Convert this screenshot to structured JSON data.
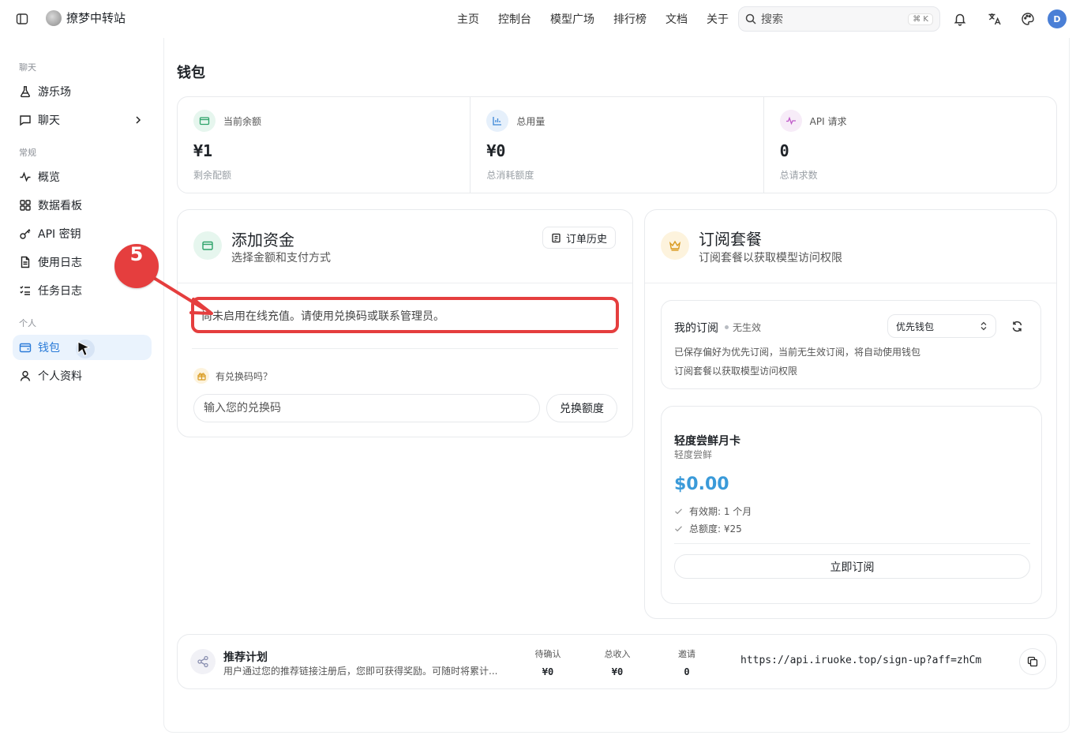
{
  "header": {
    "brand": "撩梦中转站",
    "nav": [
      "主页",
      "控制台",
      "模型广场",
      "排行榜",
      "文档",
      "关于"
    ],
    "search_placeholder": "搜索",
    "search_shortcut": "⌘ K",
    "avatar_initial": "D"
  },
  "sidebar": {
    "sections": {
      "chat": "聊天",
      "general": "常规",
      "personal": "个人"
    },
    "items": {
      "playground": "游乐场",
      "chat": "聊天",
      "overview": "概览",
      "dashboard": "数据看板",
      "api_keys": "API 密钥",
      "usage_logs": "使用日志",
      "task_logs": "任务日志",
      "wallet": "钱包",
      "profile": "个人资料"
    }
  },
  "page": {
    "title": "钱包"
  },
  "stats": [
    {
      "label": "当前余额",
      "value": "¥1",
      "sub": "剩余配额"
    },
    {
      "label": "总用量",
      "value": "¥0",
      "sub": "总消耗额度"
    },
    {
      "label": "API 请求",
      "value": "0",
      "sub": "总请求数"
    }
  ],
  "funds": {
    "title": "添加资金",
    "subtitle": "选择金额和支付方式",
    "order_history": "订单历史",
    "notice": "尚未启用在线充值。请使用兑换码或联系管理员。",
    "redeem_question": "有兑换码吗？",
    "redeem_placeholder": "输入您的兑换码",
    "redeem_button": "兑换额度"
  },
  "step_marker": "5",
  "subscription": {
    "title": "订阅套餐",
    "subtitle": "订阅套餐以获取模型访问权限",
    "my_sub_title": "我的订阅",
    "my_sub_status": "无生效",
    "preference": "优先钱包",
    "line1": "已保存偏好为优先订阅，当前无生效订阅，将自动使用钱包",
    "line2": "订阅套餐以获取模型访问权限",
    "plan": {
      "name": "轻度尝鲜月卡",
      "tag": "轻度尝鲜",
      "price": "$0.00",
      "features": [
        "有效期: 1 个月",
        "总额度: ¥25"
      ],
      "button": "立即订阅"
    }
  },
  "referral": {
    "title": "推荐计划",
    "desc": "用户通过您的推荐链接注册后，您即可获得奖励。可随时将累计...",
    "stats": [
      {
        "label": "待确认",
        "value": "¥0"
      },
      {
        "label": "总收入",
        "value": "¥0"
      },
      {
        "label": "邀请",
        "value": "0"
      }
    ],
    "link": "https://api.iruoke.top/sign-up?aff=zhCm"
  },
  "colors": {
    "accent": "#2a7bd8",
    "highlight": "#e53e3e",
    "price": "#3a9ad9"
  }
}
